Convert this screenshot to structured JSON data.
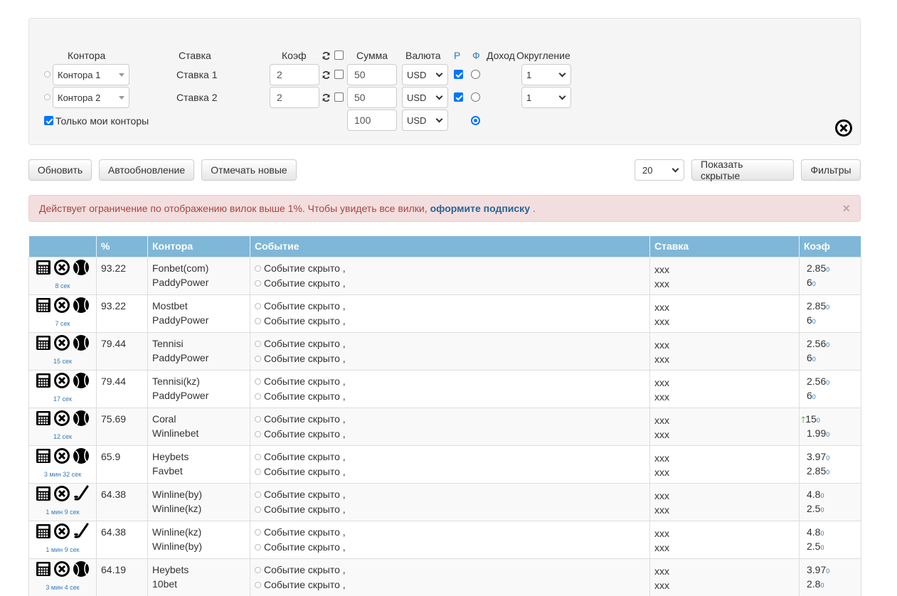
{
  "calc": {
    "headers": {
      "bookmaker": "Контора",
      "bet": "Ставка",
      "coef": "Коэф",
      "sum": "Сумма",
      "currency": "Валюта",
      "p": "Р",
      "f": "Ф",
      "income": "Доход",
      "rounding": "Округление"
    },
    "rows": [
      {
        "bookmaker": "Контора 1",
        "bet": "Ставка 1",
        "coef": "2",
        "sum": "50",
        "currency": "USD",
        "rounding": "1"
      },
      {
        "bookmaker": "Контора 2",
        "bet": "Ставка 2",
        "coef": "2",
        "sum": "50",
        "currency": "USD",
        "rounding": "1"
      }
    ],
    "total_sum": "100",
    "total_currency": "USD",
    "only_my_label": "Только мои конторы"
  },
  "toolbar": {
    "refresh": "Обновить",
    "auto_refresh": "Автообновление",
    "mark_new": "Отмечать новые",
    "page_size": "20",
    "show_hidden": "Показать скрытые",
    "filters": "Фильтры"
  },
  "alert": {
    "text": "Действует ограничение по отображению вилок выше 1%. Чтобы увидеть все вилки,",
    "link": "оформите подписку",
    "end": ".",
    "close": "×"
  },
  "table": {
    "headers": [
      "",
      "%",
      "Контора",
      "Событие",
      "Ставка",
      "Коэф"
    ],
    "rows": [
      {
        "sport": "tennis",
        "age": "8 сек",
        "pct": "93.22",
        "books": [
          "Fonbet(com)",
          "PaddyPower"
        ],
        "events": [
          "Событие скрыто ,",
          "Событие скрыто ,"
        ],
        "bets": [
          "xxx",
          "xxx"
        ],
        "coefs": [
          "2.85",
          "6"
        ],
        "subs": [
          "0",
          "0"
        ],
        "up": false
      },
      {
        "sport": "tennis",
        "age": "7 сек",
        "pct": "93.22",
        "books": [
          "Mostbet",
          "PaddyPower"
        ],
        "events": [
          "Событие скрыто ,",
          "Событие скрыто ,"
        ],
        "bets": [
          "xxx",
          "xxx"
        ],
        "coefs": [
          "2.85",
          "6"
        ],
        "subs": [
          "0",
          "0"
        ],
        "up": false
      },
      {
        "sport": "tennis",
        "age": "15 сек",
        "pct": "79.44",
        "books": [
          "Tennisi",
          "PaddyPower"
        ],
        "events": [
          "Событие скрыто ,",
          "Событие скрыто ,"
        ],
        "bets": [
          "xxx",
          "xxx"
        ],
        "coefs": [
          "2.56",
          "6"
        ],
        "subs": [
          "0",
          "0"
        ],
        "up": false
      },
      {
        "sport": "tennis",
        "age": "17 сек",
        "pct": "79.44",
        "books": [
          "Tennisi(kz)",
          "PaddyPower"
        ],
        "events": [
          "Событие скрыто ,",
          "Событие скрыто ,"
        ],
        "bets": [
          "xxx",
          "xxx"
        ],
        "coefs": [
          "2.56",
          "6"
        ],
        "subs": [
          "0",
          "0"
        ],
        "up": false
      },
      {
        "sport": "tennis",
        "age": "12 сек",
        "pct": "75.69",
        "books": [
          "Coral",
          "Winlinebet"
        ],
        "events": [
          "Событие скрыто ,",
          "Событие скрыто ,"
        ],
        "bets": [
          "xxx",
          "xxx"
        ],
        "coefs": [
          "15",
          "1.99"
        ],
        "subs": [
          "0",
          "0"
        ],
        "up": true
      },
      {
        "sport": "tennis",
        "age": "3 мин 32 сек",
        "pct": "65.9",
        "books": [
          "Heybets",
          "Favbet"
        ],
        "events": [
          "Событие скрыто ,",
          "Событие скрыто ,"
        ],
        "bets": [
          "xxx",
          "xxx"
        ],
        "coefs": [
          "3.97",
          "2.85"
        ],
        "subs": [
          "0",
          "0"
        ],
        "up": false
      },
      {
        "sport": "hockey",
        "age": "1 мин 9 сек",
        "pct": "64.38",
        "books": [
          "Winline(by)",
          "Winline(kz)"
        ],
        "events": [
          "Событие скрыто ,",
          "Событие скрыто ,"
        ],
        "bets": [
          "xxx",
          "xxx"
        ],
        "coefs": [
          "4.8",
          "2.5"
        ],
        "subs": [
          "0",
          "0"
        ],
        "up": false
      },
      {
        "sport": "hockey",
        "age": "1 мин 9 сек",
        "pct": "64.38",
        "books": [
          "Winline(kz)",
          "Winline(by)"
        ],
        "events": [
          "Событие скрыто ,",
          "Событие скрыто ,"
        ],
        "bets": [
          "xxx",
          "xxx"
        ],
        "coefs": [
          "4.8",
          "2.5"
        ],
        "subs": [
          "0",
          "0"
        ],
        "up": false
      },
      {
        "sport": "tennis",
        "age": "3 мин 4 сек",
        "pct": "64.19",
        "books": [
          "Heybets",
          "10bet"
        ],
        "events": [
          "Событие скрыто ,",
          "Событие скрыто ,"
        ],
        "bets": [
          "xxx",
          "xxx"
        ],
        "coefs": [
          "3.97",
          "2.8"
        ],
        "subs": [
          "0",
          "0"
        ],
        "up": false
      }
    ]
  }
}
